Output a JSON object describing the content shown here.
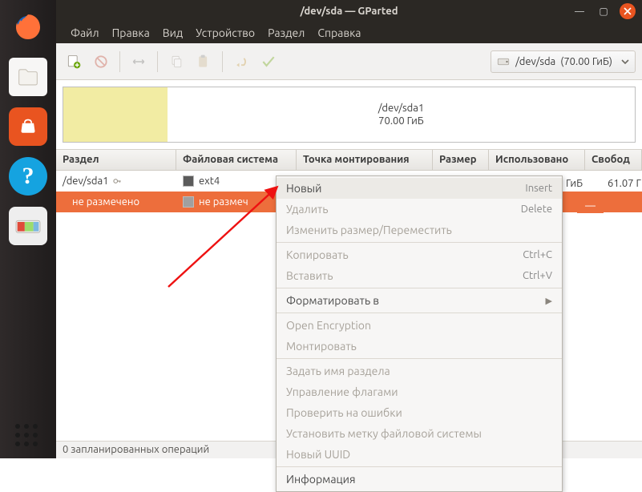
{
  "window_title": "/dev/sda — GParted",
  "menubar": [
    "Файл",
    "Правка",
    "Вид",
    "Устройство",
    "Раздел",
    "Справка"
  ],
  "device_selector": {
    "name": "/dev/sda",
    "size": "(70.00 ГиБ)"
  },
  "partition_map": {
    "name": "/dev/sda1",
    "size": "70.00 ГиБ"
  },
  "columns": {
    "partition": "Раздел",
    "fs": "Файловая система",
    "mount": "Точка монтирования",
    "size": "Размер",
    "used": "Использовано",
    "free": "Свобод"
  },
  "rows": [
    {
      "name": "/dev/sda1",
      "fs": "ext4",
      "locked": true,
      "used_unit": "ГиБ",
      "free": "61.07 Г"
    },
    {
      "name": "не размечено",
      "fs": "не размеч",
      "used_unit": "—",
      "selected": true
    }
  ],
  "statusbar": "0 запланированных операций",
  "context_menu": {
    "items": [
      {
        "label": "Новый",
        "accel": "Insert",
        "enabled": true,
        "highlighted": true
      },
      {
        "label": "Удалить",
        "accel": "Delete",
        "enabled": false
      },
      {
        "label": "Изменить размер/Переместить",
        "enabled": false
      },
      {
        "sep": true
      },
      {
        "label": "Копировать",
        "accel": "Ctrl+C",
        "enabled": false
      },
      {
        "label": "Вставить",
        "accel": "Ctrl+V",
        "enabled": false
      },
      {
        "sep": true
      },
      {
        "label": "Форматировать в",
        "submenu": true,
        "enabled": true
      },
      {
        "sep": true
      },
      {
        "label": "Open Encryption",
        "enabled": false
      },
      {
        "label": "Монтировать",
        "enabled": false
      },
      {
        "sep": true
      },
      {
        "label": "Задать имя раздела",
        "enabled": false
      },
      {
        "label": "Управление флагами",
        "enabled": false
      },
      {
        "label": "Проверить на ошибки",
        "enabled": false
      },
      {
        "label": "Установить метку файловой системы",
        "enabled": false
      },
      {
        "label": "Новый UUID",
        "enabled": false
      },
      {
        "sep": true
      },
      {
        "label": "Информация",
        "enabled": true
      }
    ]
  },
  "dock": {
    "items": [
      "firefox",
      "files",
      "software",
      "help",
      "gparted"
    ],
    "help_glyph": "?"
  }
}
